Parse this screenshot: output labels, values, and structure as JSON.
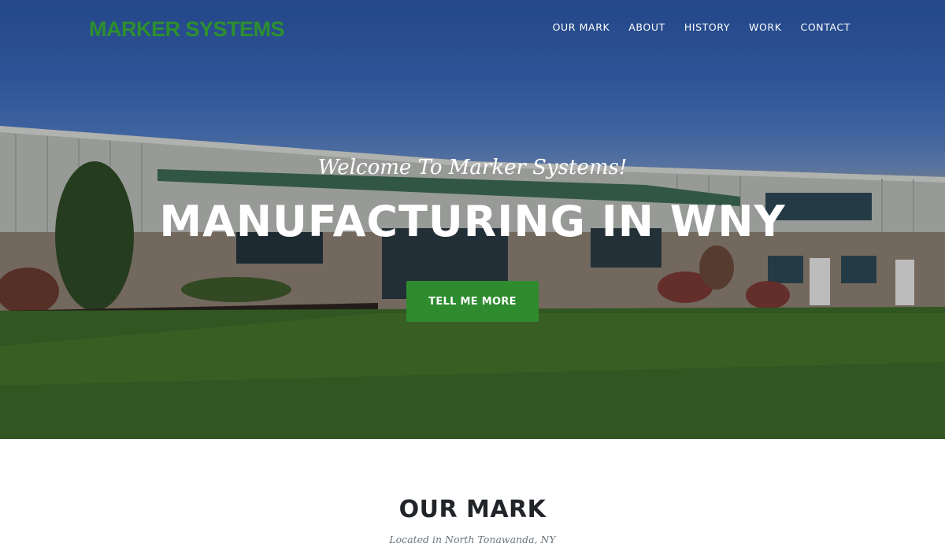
{
  "brand": {
    "name": "MARKER SYSTEMS",
    "color": "#2e8f2e"
  },
  "nav": {
    "items": [
      {
        "label": "OUR MARK"
      },
      {
        "label": "ABOUT"
      },
      {
        "label": "HISTORY"
      },
      {
        "label": "WORK"
      },
      {
        "label": "CONTACT"
      }
    ]
  },
  "hero": {
    "subheading": "Welcome To Marker Systems!",
    "heading": "MANUFACTURING IN WNY",
    "button_label": "TELL ME MORE",
    "button_color": "#2e8b2e"
  },
  "section": {
    "title": "OUR MARK",
    "subtitle": "Located in North Tonawanda, NY"
  }
}
